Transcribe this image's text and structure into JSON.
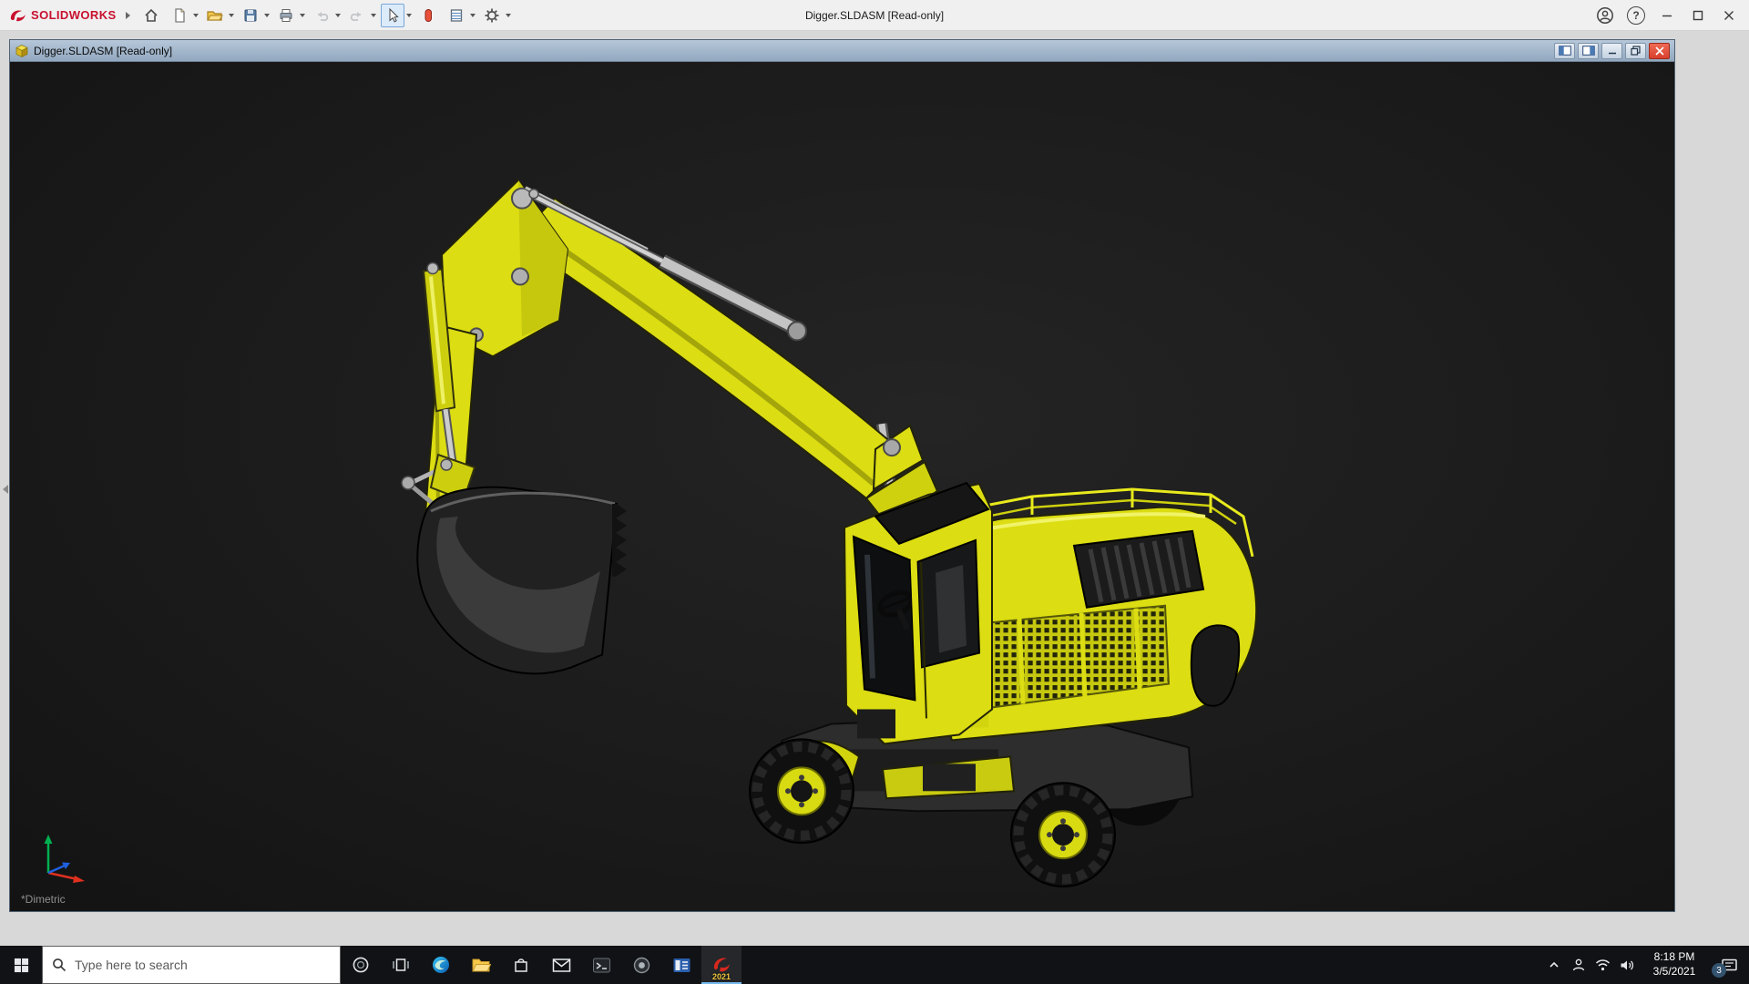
{
  "app": {
    "brand_name": "SOLIDWORKS",
    "document_title": "Digger.SLDASM [Read-only]"
  },
  "document_window": {
    "title": "Digger.SLDASM [Read-only]",
    "view_orientation": "*Dimetric"
  },
  "taskbar": {
    "search_placeholder": "Type here to search",
    "solidworks_year": "2021",
    "clock": {
      "time": "8:18 PM",
      "date": "3/5/2021"
    },
    "notification_count": "3"
  },
  "icons": {
    "help_glyph": "?"
  },
  "colors": {
    "brand_red": "#c8102e",
    "model_yellow": "#dcdd12",
    "doc_titlebar_blue": "#9db3c8",
    "close_button_red": "#e25041",
    "taskbar_background": "#101215",
    "viewport_background": "#1b1b1b"
  }
}
